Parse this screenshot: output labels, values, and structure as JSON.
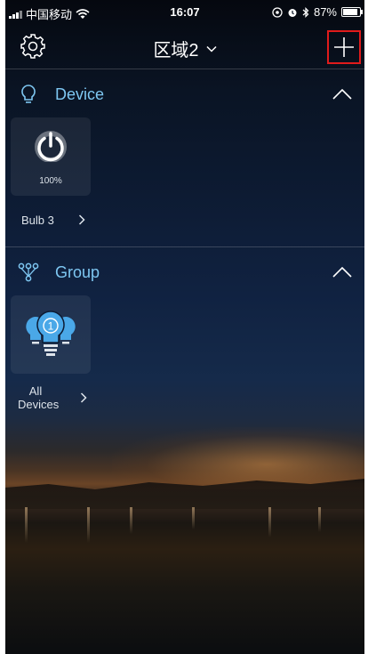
{
  "status_bar": {
    "carrier": "中国移动",
    "time": "16:07",
    "battery": "87%",
    "battery_level": 0.87
  },
  "header": {
    "title": "区域2",
    "settings_icon": "gear-icon",
    "dropdown_icon": "chevron-down-icon",
    "add_icon": "plus-icon",
    "highlight_color": "#e01b1b"
  },
  "device_section": {
    "title": "Device",
    "icon": "lightbulb-outline-icon",
    "items": [
      {
        "label": "Bulb 3",
        "brightness": "100%",
        "icon": "power-icon"
      }
    ]
  },
  "group_section": {
    "title": "Group",
    "icon": "group-nodes-icon",
    "items": [
      {
        "label_line1": "All",
        "label_line2": "Devices",
        "count": "1",
        "icon": "bulb-group-icon"
      }
    ]
  },
  "colors": {
    "accent": "#7ec7f2",
    "bulb": "#4aa8e8"
  }
}
